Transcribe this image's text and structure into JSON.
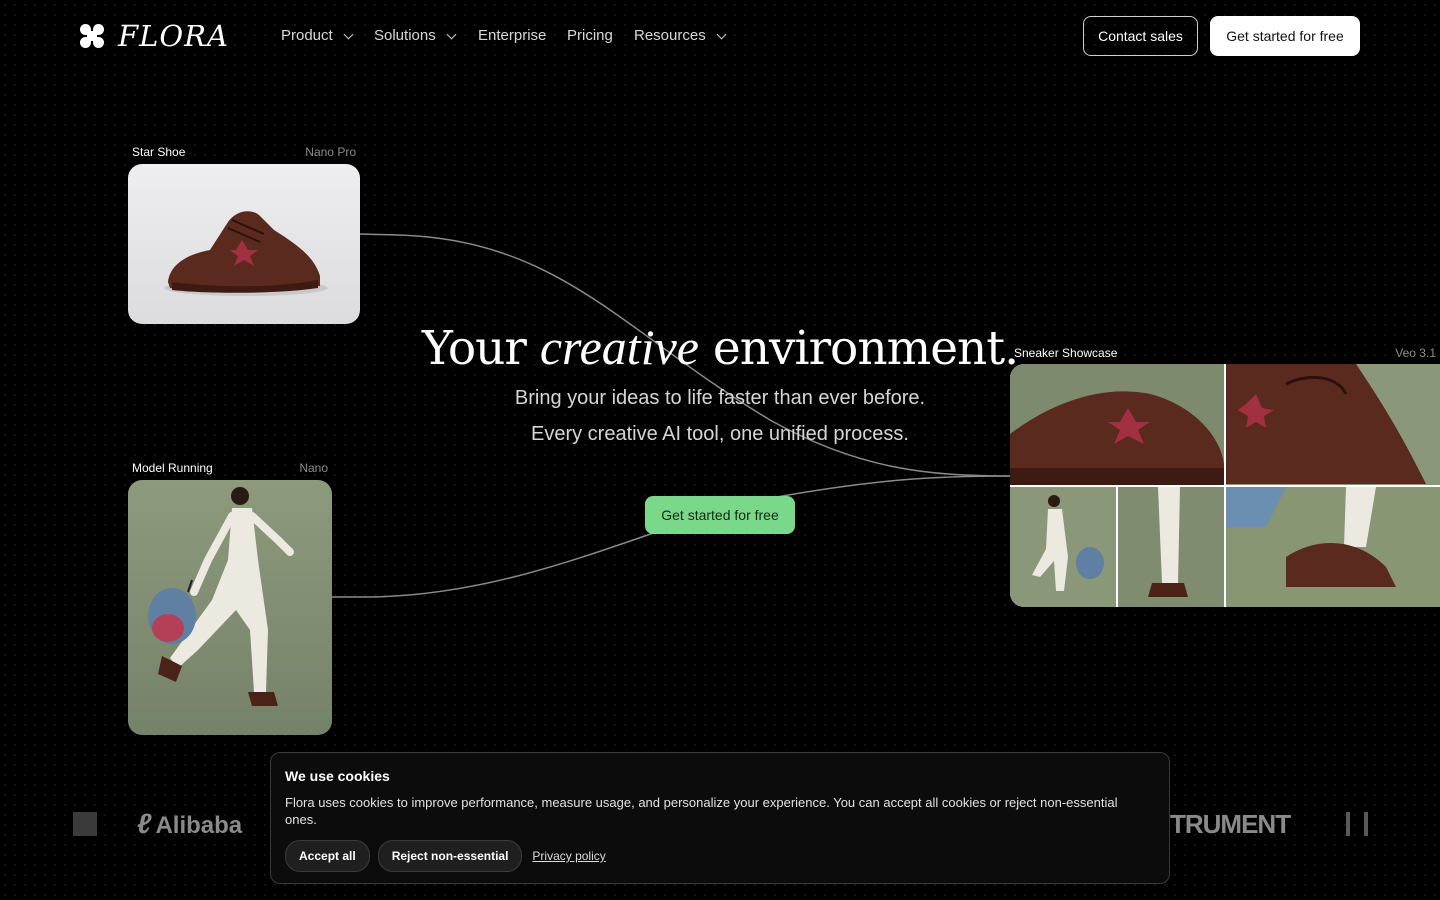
{
  "nav": {
    "brand": "FLORA",
    "items": [
      {
        "label": "Product",
        "has_menu": true
      },
      {
        "label": "Solutions",
        "has_menu": true
      },
      {
        "label": "Enterprise",
        "has_menu": false
      },
      {
        "label": "Pricing",
        "has_menu": false
      },
      {
        "label": "Resources",
        "has_menu": true
      }
    ],
    "contact_sales": "Contact sales",
    "get_started": "Get started for free"
  },
  "hero": {
    "title_start": "Your",
    "title_italic": "creative",
    "title_end": "environment.",
    "subtitle_1": "Bring your ideas to life faster than ever before.",
    "subtitle_2": "Every creative AI tool, one unified process.",
    "cta": "Get started for free",
    "accent_color": "#7ad88a"
  },
  "cards": {
    "star_shoe": {
      "label": "Star Shoe",
      "model": "Nano Pro"
    },
    "model_running": {
      "label": "Model Running",
      "model": "Nano"
    },
    "sneaker_showcase": {
      "label": "Sneaker Showcase",
      "model": "Veo 3.1"
    }
  },
  "logo_strip": [
    "Alibaba",
    "TRUMENT"
  ],
  "cookie": {
    "title": "We use cookies",
    "text": "Flora uses cookies to improve performance, measure usage, and personalize your experience. You can accept all cookies or reject non-essential ones.",
    "accept": "Accept all",
    "reject": "Reject non-essential",
    "privacy": "Privacy policy"
  }
}
